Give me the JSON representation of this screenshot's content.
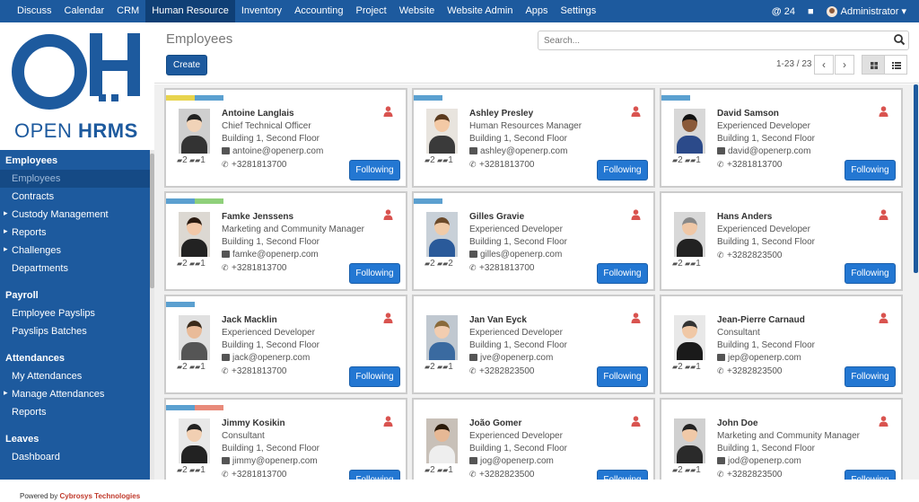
{
  "topbar": {
    "menu": [
      "Discuss",
      "Calendar",
      "CRM",
      "Human Resource",
      "Inventory",
      "Accounting",
      "Project",
      "Website",
      "Website Admin",
      "Apps",
      "Settings"
    ],
    "active": "Human Resource",
    "messages_count": "24",
    "user": "Administrator"
  },
  "logo": {
    "line1": "OPEN",
    "line2": "HRMS"
  },
  "sidebar": {
    "employees_header": "Employees",
    "employees_items": [
      {
        "label": "Employees",
        "selected": true,
        "sub": false
      },
      {
        "label": "Contracts",
        "selected": false,
        "sub": false
      },
      {
        "label": "Custody Management",
        "selected": false,
        "sub": true
      },
      {
        "label": "Reports",
        "selected": false,
        "sub": true
      },
      {
        "label": "Challenges",
        "selected": false,
        "sub": true
      },
      {
        "label": "Departments",
        "selected": false,
        "sub": false
      }
    ],
    "payroll_header": "Payroll",
    "payroll_items": [
      "Employee Payslips",
      "Payslips Batches"
    ],
    "attendances_header": "Attendances",
    "attendances_items": [
      {
        "label": "My Attendances",
        "sub": false
      },
      {
        "label": "Manage Attendances",
        "sub": true
      },
      {
        "label": "Reports",
        "sub": false
      }
    ],
    "leaves_header": "Leaves",
    "leaves_items": [
      "Dashboard"
    ],
    "powered_by": "Powered by",
    "powered_company": "Cybrosys Technologies"
  },
  "control": {
    "title": "Employees",
    "create_label": "Create",
    "search_placeholder": "Search...",
    "pager": "1-23 / 23"
  },
  "colors": {
    "brand": "#1d5a9e",
    "button": "#2377d2",
    "tag_yellow": "#e8d44d",
    "tag_blue": "#5ba0d0",
    "tag_green": "#8fd07a",
    "tag_salmon": "#e88a7a",
    "person_icon": "#d9534f"
  },
  "employees": [
    {
      "name": "Antoine Langlais",
      "job": "Chief Technical Officer",
      "location": "Building 1, Second Floor",
      "email": "antoine@openerp.com",
      "phone": "+3281813700",
      "messages": "2",
      "followers": "1",
      "follow_label": "Following",
      "tags": [
        "#e8d44d",
        "#5ba0d0"
      ]
    },
    {
      "name": "Ashley Presley",
      "job": "Human Resources Manager",
      "location": "Building 1, Second Floor",
      "email": "ashley@openerp.com",
      "phone": "+3281813700",
      "messages": "2",
      "followers": "1",
      "follow_label": "Following",
      "tags": [
        "#5ba0d0"
      ]
    },
    {
      "name": "David Samson",
      "job": "Experienced Developer",
      "location": "Building 1, Second Floor",
      "email": "david@openerp.com",
      "phone": "+3281813700",
      "messages": "2",
      "followers": "1",
      "follow_label": "Following",
      "tags": [
        "#5ba0d0"
      ]
    },
    {
      "name": "Famke Jenssens",
      "job": "Marketing and Community Manager",
      "location": "Building 1, Second Floor",
      "email": "famke@openerp.com",
      "phone": "+3281813700",
      "messages": "2",
      "followers": "1",
      "follow_label": "Following",
      "tags": [
        "#5ba0d0",
        "#8fd07a"
      ]
    },
    {
      "name": "Gilles Gravie",
      "job": "Experienced Developer",
      "location": "Building 1, Second Floor",
      "email": "gilles@openerp.com",
      "phone": "+3281813700",
      "messages": "2",
      "followers": "2",
      "follow_label": "Following",
      "tags": [
        "#5ba0d0"
      ]
    },
    {
      "name": "Hans Anders",
      "job": "Experienced Developer",
      "location": "Building 1, Second Floor",
      "email": "",
      "phone": "+3282823500",
      "messages": "2",
      "followers": "1",
      "follow_label": "Following",
      "tags": []
    },
    {
      "name": "Jack Macklin",
      "job": "Experienced Developer",
      "location": "Building 1, Second Floor",
      "email": "jack@openerp.com",
      "phone": "+3281813700",
      "messages": "2",
      "followers": "1",
      "follow_label": "Following",
      "tags": [
        "#5ba0d0"
      ]
    },
    {
      "name": "Jan Van Eyck",
      "job": "Experienced Developer",
      "location": "Building 1, Second Floor",
      "email": "jve@openerp.com",
      "phone": "+3282823500",
      "messages": "2",
      "followers": "1",
      "follow_label": "Following",
      "tags": []
    },
    {
      "name": "Jean-Pierre Carnaud",
      "job": "Consultant",
      "location": "Building 1, Second Floor",
      "email": "jep@openerp.com",
      "phone": "+3282823500",
      "messages": "2",
      "followers": "1",
      "follow_label": "Following",
      "tags": []
    },
    {
      "name": "Jimmy Kosikin",
      "job": "Consultant",
      "location": "Building 1, Second Floor",
      "email": "jimmy@openerp.com",
      "phone": "+3281813700",
      "messages": "2",
      "followers": "1",
      "follow_label": "Following",
      "tags": [
        "#5ba0d0",
        "#e88a7a"
      ]
    },
    {
      "name": "João Gomer",
      "job": "Experienced Developer",
      "location": "Building 1, Second Floor",
      "email": "jog@openerp.com",
      "phone": "+3282823500",
      "messages": "2",
      "followers": "1",
      "follow_label": "Following",
      "tags": []
    },
    {
      "name": "John Doe",
      "job": "Marketing and Community Manager",
      "location": "Building 1, Second Floor",
      "email": "jod@openerp.com",
      "phone": "+3282823500",
      "messages": "2",
      "followers": "1",
      "follow_label": "Following",
      "tags": []
    }
  ]
}
